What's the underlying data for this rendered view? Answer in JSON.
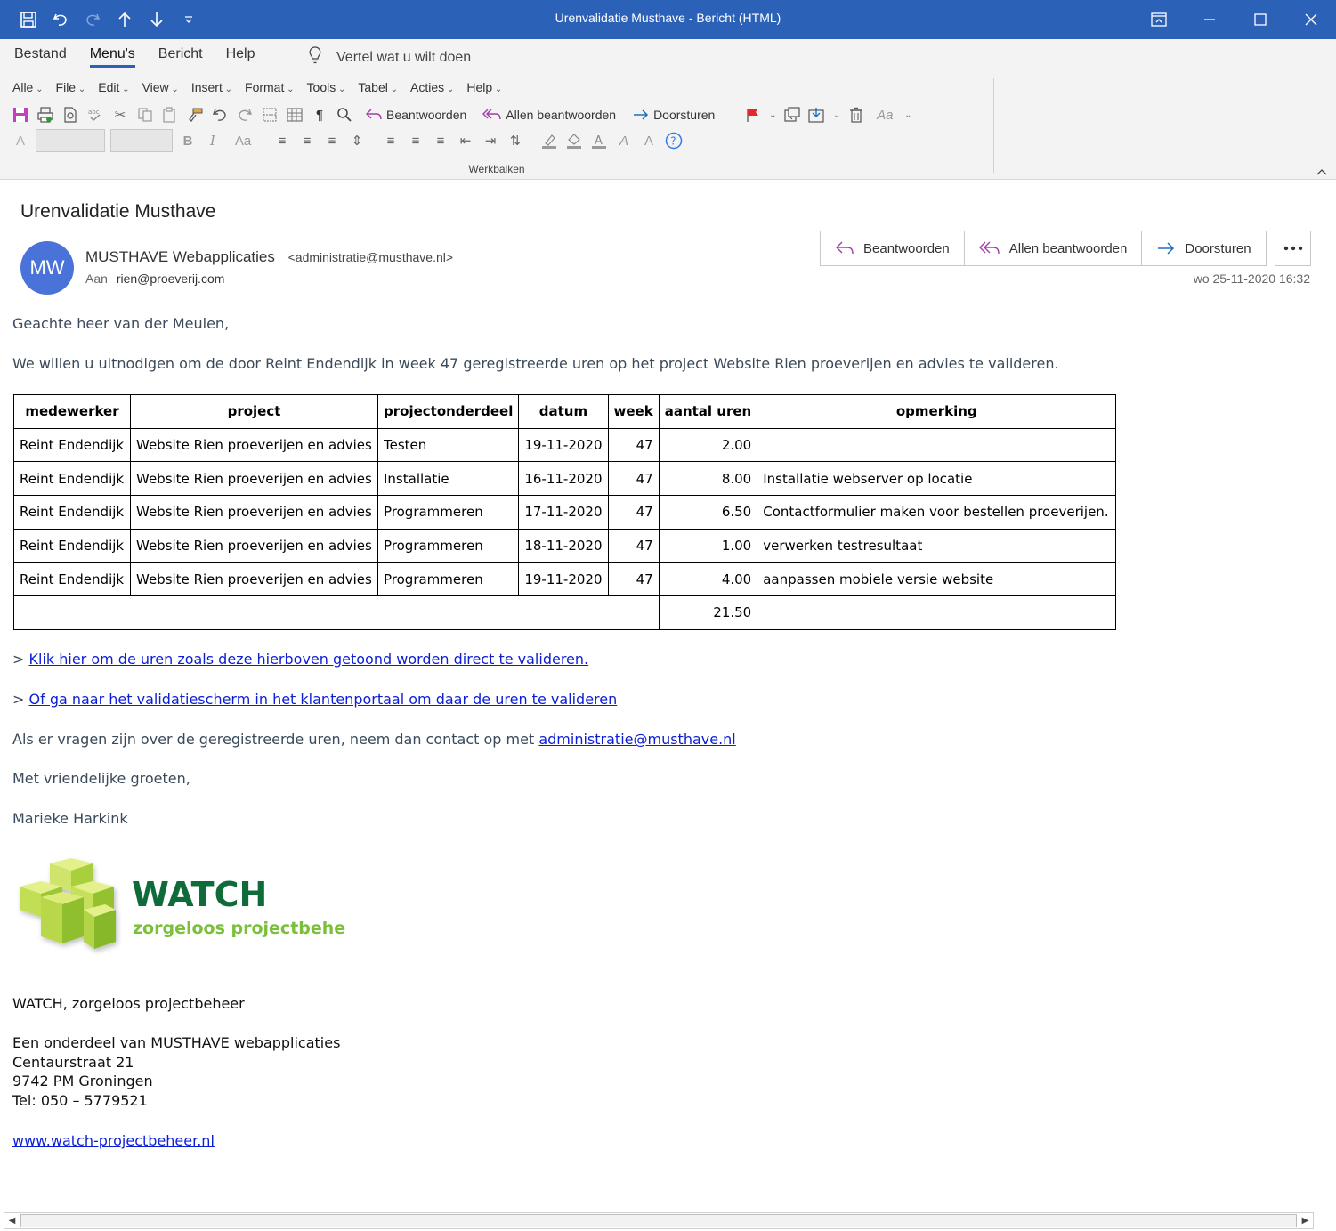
{
  "window": {
    "title": "Urenvalidatie Musthave  -  Bericht (HTML)"
  },
  "ribbon": {
    "tabs": [
      "Bestand",
      "Menu's",
      "Bericht",
      "Help"
    ],
    "tell_me": "Vertel wat u wilt doen",
    "menus": [
      "Alle",
      "File",
      "Edit",
      "View",
      "Insert",
      "Format",
      "Tools",
      "Tabel",
      "Acties",
      "Help"
    ],
    "reply": "Beantwoorden",
    "reply_all": "Allen beantwoorden",
    "forward": "Doorsturen",
    "group_label": "Werkbalken",
    "style_label": "Aa"
  },
  "message": {
    "subject": "Urenvalidatie Musthave",
    "avatar_initials": "MW",
    "sender_name": "MUSTHAVE Webapplicaties",
    "sender_email": "<administratie@musthave.nl>",
    "to_label": "Aan",
    "to_address": "rien@proeverij.com",
    "date": "wo 25-11-2020 16:32",
    "actions": {
      "reply": "Beantwoorden",
      "reply_all": "Allen beantwoorden",
      "forward": "Doorsturen"
    }
  },
  "body": {
    "greeting": "Geachte heer van der Meulen,",
    "intro": "We willen u uitnodigen om de door Reint Endendijk in week 47 geregistreerde uren op het project Website Rien proeverijen en advies te valideren.",
    "table": {
      "headers": [
        "medewerker",
        "project",
        "projectonderdeel",
        "datum",
        "week",
        "aantal uren",
        "opmerking"
      ],
      "rows": [
        [
          "Reint Endendijk",
          "Website Rien proeverijen en advies",
          "Testen",
          "19-11-2020",
          "47",
          "2.00",
          ""
        ],
        [
          "Reint Endendijk",
          "Website Rien proeverijen en advies",
          "Installatie",
          "16-11-2020",
          "47",
          "8.00",
          "Installatie webserver op locatie"
        ],
        [
          "Reint Endendijk",
          "Website Rien proeverijen en advies",
          "Programmeren",
          "17-11-2020",
          "47",
          "6.50",
          "Contactformulier maken voor bestellen proeverijen."
        ],
        [
          "Reint Endendijk",
          "Website Rien proeverijen en advies",
          "Programmeren",
          "18-11-2020",
          "47",
          "1.00",
          "verwerken testresultaat"
        ],
        [
          "Reint Endendijk",
          "Website Rien proeverijen en advies",
          "Programmeren",
          "19-11-2020",
          "47",
          "4.00",
          "aanpassen mobiele versie website"
        ]
      ],
      "total": "21.50"
    },
    "link_prefix": ">",
    "link1": "Klik hier om de uren zoals deze hierboven getoond worden direct te valideren.",
    "link2": "Of ga naar het validatiescherm in het klantenportaal om daar de uren te valideren",
    "questions": "Als er vragen zijn over de geregistreerde uren, neem dan contact op met",
    "contact_email": "administratie@musthave.nl",
    "closing": "Met vriendelijke groeten,",
    "signature_name": "Marieke Harkink"
  },
  "logo": {
    "name": "WATCH",
    "tagline": "zorgeloos projectbeheer",
    "colors": {
      "name": "#0f6b3a",
      "tagline": "#7cbf3a",
      "cube_light": "#e4f08a",
      "cube_mid": "#b9d84a",
      "cube_dark": "#8fbf2f"
    }
  },
  "signature": {
    "company_line": "WATCH, zorgeloos projectbeheer",
    "lines": [
      "Een onderdeel van MUSTHAVE webapplicaties",
      "Centaurstraat 21",
      "9742 PM Groningen",
      "Tel: 050 – 5779521"
    ],
    "website": "www.watch-projectbeheer.nl"
  },
  "colors": {
    "titlebar": "#2b62b8",
    "avatar": "#4a73d9",
    "link": "#0b1ed6",
    "body_text": "#3a4a5a"
  }
}
